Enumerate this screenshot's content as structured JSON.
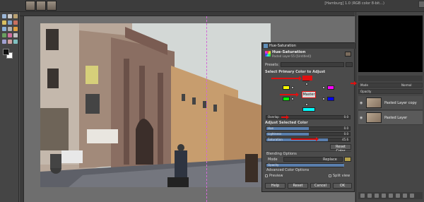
{
  "window": {
    "tab_title": "[Hamburg] 1.0 (RGB color 8-bit...)"
  },
  "dialog": {
    "title": "Hue-Saturation",
    "header_title": "Hue-Saturation",
    "header_subtitle": "Pasted Layer-55 ([Untitled])",
    "presets_label": "Presets:",
    "select_label": "Select Primary Color to Adjust",
    "master_label": "Master",
    "color_swatches": [
      "#ff0000",
      "#ffff00",
      "#00ff00",
      "#00ffff",
      "#0000ff",
      "#ff00ff"
    ],
    "overlap_label": "Overlap",
    "overlap_value": "0.0",
    "adjust_label": "Adjust Selected Color",
    "sliders": [
      {
        "name": "Hue",
        "value": "0.0"
      },
      {
        "name": "Lightness",
        "value": "0.0"
      },
      {
        "name": "Saturation",
        "value": "45.6"
      }
    ],
    "reset_color_label": "Reset Color",
    "blending_label": "Blending Options",
    "mode_label": "Mode",
    "mode_value": "Replace",
    "opacity_label": "Opacity",
    "advanced_label": "Advanced Color Options",
    "preview_label": "Preview",
    "split_label": "Split view",
    "buttons": {
      "help": "Help",
      "reset": "Reset",
      "cancel": "Cancel",
      "ok": "OK"
    }
  },
  "dock": {
    "mode_label": "Mode",
    "mode_value": "Normal",
    "opacity_label": "Opacity",
    "layers": [
      {
        "name": "Pasted Layer copy"
      },
      {
        "name": "Pasted Layer"
      }
    ]
  },
  "colors": {
    "annotation_red": "#e01010",
    "guide": "#d36ad8",
    "accent": "#5a7fae"
  }
}
